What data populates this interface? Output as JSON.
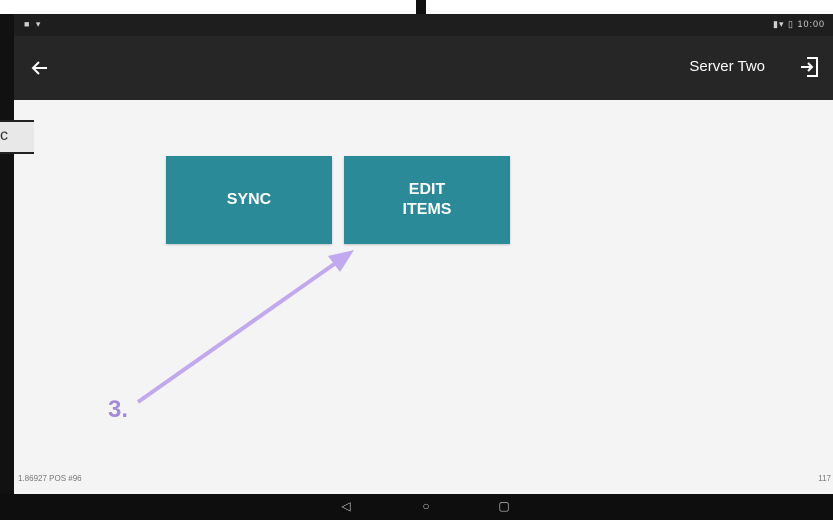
{
  "status_bar": {
    "left": "■ ▾",
    "right": "▮▾ ▯ 10:00"
  },
  "action_bar": {
    "server_name": "Server Two",
    "back_icon": "arrow-left-icon",
    "logout_icon": "logout-icon"
  },
  "tiles": [
    {
      "label": "SYNC"
    },
    {
      "label": "EDIT\nITEMS"
    }
  ],
  "annotation": {
    "step": "3."
  },
  "footer": {
    "left": "1.86927 POS #96",
    "right": "117"
  },
  "nav": {
    "back": "◁",
    "home": "○",
    "recent": "▢"
  },
  "colors": {
    "tile": "#2b8a97",
    "action_bar": "#262626",
    "annotation": "#a58ad8"
  }
}
